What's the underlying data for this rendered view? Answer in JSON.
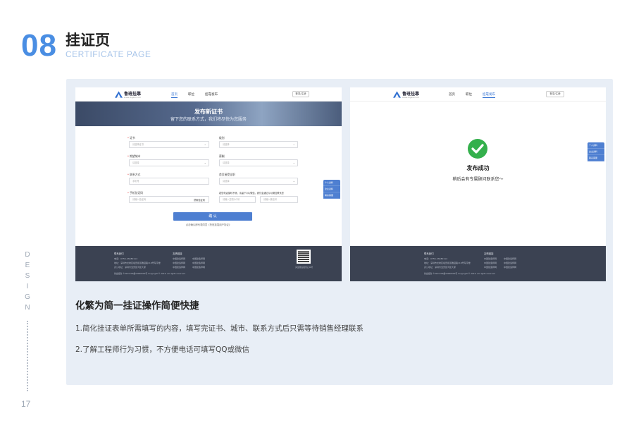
{
  "header": {
    "section_number": "08",
    "title": "挂证页",
    "subtitle": "CERTIFICATE PAGE"
  },
  "side": {
    "design_letters": [
      "D",
      "E",
      "S",
      "I",
      "G",
      "N"
    ],
    "page_number": "17"
  },
  "site": {
    "logo_name": "鲁班挂靠",
    "logo_url": "www.lbgkw.com",
    "nav": [
      "首页",
      "职位",
      "挂靠发布"
    ],
    "login_button": "登录/注册"
  },
  "form_page": {
    "banner_title": "发布新证书",
    "banner_subtitle": "留下您的联系方式，我们将尽快为您服务",
    "fields": [
      {
        "label": "证书",
        "required": true,
        "placeholder": "请选择证书",
        "dropdown": true
      },
      {
        "label": "级别",
        "required": false,
        "placeholder": "请选择",
        "dropdown": true
      },
      {
        "label": "期望城市",
        "required": true,
        "placeholder": "请选择",
        "dropdown": true
      },
      {
        "label": "薪酬",
        "required": false,
        "placeholder": "请选择",
        "dropdown": true
      },
      {
        "label": "联系方式",
        "required": true,
        "placeholder": "手机号",
        "dropdown": false
      },
      {
        "label": "首页接受全职",
        "required": false,
        "placeholder": "请选择",
        "dropdown": true
      }
    ],
    "verify_label": "手机验证码",
    "verify_placeholder": "请输入验证码",
    "get_code": "获取验证码",
    "alt_contact_label": "若您电话接听不便，请留下QQ/微信，我们会通过QQ/微信联系您",
    "qq_placeholder": "请输入您的QQ号",
    "wechat_placeholder": "请输入微信号",
    "submit": "确 认",
    "agree_note": "点击确认即代表同意《鲁班挂靠用户协议》"
  },
  "float_menu": [
    "个人资料",
    "企业资料",
    "联系客服"
  ],
  "footer": {
    "contact_heading": "联系我们",
    "links_heading": "友情链接",
    "contact_lines": [
      "电话：0755-23480114",
      "地址：深圳市龙岗区坂田街道雅园路118号写字楼",
      "办公地址：深圳市宝安区湾区大厦"
    ],
    "links_col1": [
      "中国建造师网",
      "中国建造师网",
      "中国建造师网"
    ],
    "links_col2": [
      "中国建造师网",
      "中国建造师网",
      "中国建造师网"
    ],
    "qr_caption": "关注鲁班挂靠公众号",
    "copyright": "鲁班挂靠 ©2019 ICP备18000000号 Copyright © 2019. All rights reserved"
  },
  "success_page": {
    "title": "发布成功",
    "subtitle": "稍后会有专属顾问联系您～"
  },
  "description": {
    "title": "化繁为简一挂证操作简便快捷",
    "points": [
      "1.简化挂证表单所需填写的内容，填写完证书、城市、联系方式后只需等待销售经理联系",
      "2.了解工程师行为习惯，不方便电话可填写QQ或微信"
    ]
  },
  "colors": {
    "accent": "#4a8ee3",
    "panel_bg": "#e8eef6",
    "button_blue": "#4e7fd1",
    "footer_bg": "#3b4252",
    "success_green": "#34b04c"
  }
}
